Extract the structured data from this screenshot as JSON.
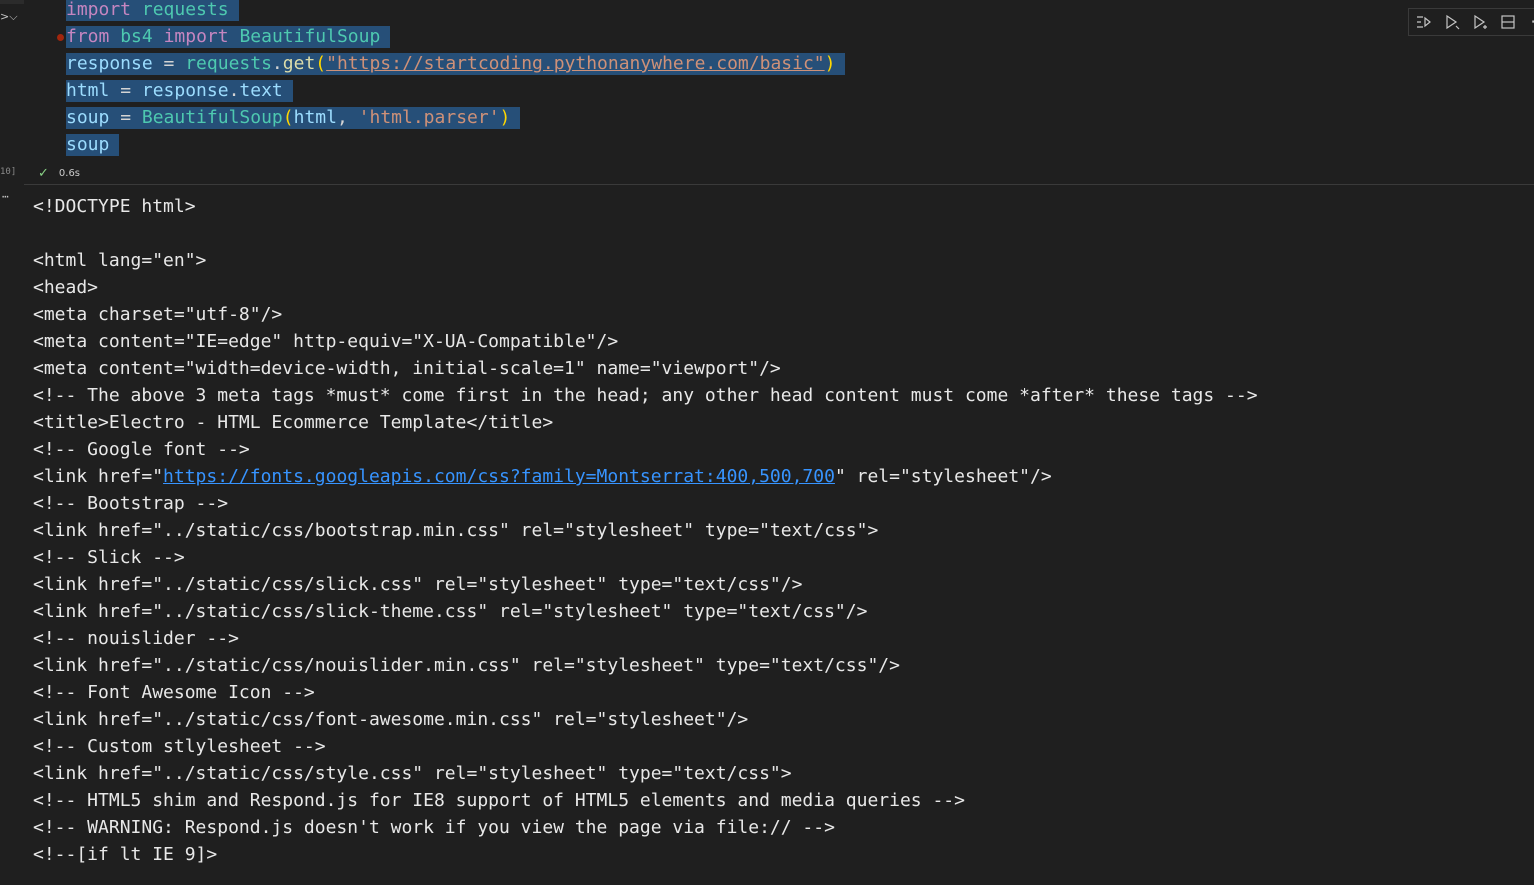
{
  "gutter": {
    "exec_count": "10]"
  },
  "code_cell": {
    "lines": [
      "import requests",
      "from bs4 import BeautifulSoup",
      "response = requests.get(\"https://startcoding.pythonanywhere.com/basic\")",
      "html = response.text",
      "soup = BeautifulSoup(html, 'html.parser')",
      "soup"
    ]
  },
  "toolbar": {
    "icons": [
      "run-by-line-icon",
      "execute-above-icon",
      "execute-below-icon",
      "split-cell-icon",
      "more-icon"
    ]
  },
  "status": {
    "check_glyph": "✓",
    "duration": "0.6s"
  },
  "output": {
    "lines": [
      "<!DOCTYPE html>",
      "",
      "<html lang=\"en\">",
      "<head>",
      "<meta charset=\"utf-8\"/>",
      "<meta content=\"IE=edge\" http-equiv=\"X-UA-Compatible\"/>",
      "<meta content=\"width=device-width, initial-scale=1\" name=\"viewport\"/>",
      "<!-- The above 3 meta tags *must* come first in the head; any other head content must come *after* these tags -->",
      "<title>Electro - HTML Ecommerce Template</title>",
      "<!-- Google font -->",
      "<link href=\"https://fonts.googleapis.com/css?family=Montserrat:400,500,700\" rel=\"stylesheet\"/>",
      "<!-- Bootstrap -->",
      "<link href=\"../static/css/bootstrap.min.css\" rel=\"stylesheet\" type=\"text/css\">",
      "<!-- Slick -->",
      "<link href=\"../static/css/slick.css\" rel=\"stylesheet\" type=\"text/css\"/>",
      "<link href=\"../static/css/slick-theme.css\" rel=\"stylesheet\" type=\"text/css\"/>",
      "<!-- nouislider -->",
      "<link href=\"../static/css/nouislider.min.css\" rel=\"stylesheet\" type=\"text/css\"/>",
      "<!-- Font Awesome Icon -->",
      "<link href=\"../static/css/font-awesome.min.css\" rel=\"stylesheet\"/>",
      "<!-- Custom stlylesheet -->",
      "<link href=\"../static/css/style.css\" rel=\"stylesheet\" type=\"text/css\">",
      "<!-- HTML5 shim and Respond.js for IE8 support of HTML5 elements and media queries -->",
      "<!-- WARNING: Respond.js doesn't work if you view the page via file:// -->",
      "<!--[if lt IE 9]>"
    ],
    "link_prefix": "<link href=\"",
    "link_url": "https://fonts.googleapis.com/css?family=Montserrat:400,500,700",
    "link_suffix": "\" rel=\"stylesheet\"/>"
  },
  "colors": {
    "background": "#1f1f1f",
    "selection": "#264f78",
    "keyword": "#c586c0",
    "module": "#4ec9b0",
    "variable": "#9cdcfe",
    "function": "#dcdcaa",
    "string": "#ce9178",
    "link": "#3794ff",
    "success": "#89d185"
  }
}
